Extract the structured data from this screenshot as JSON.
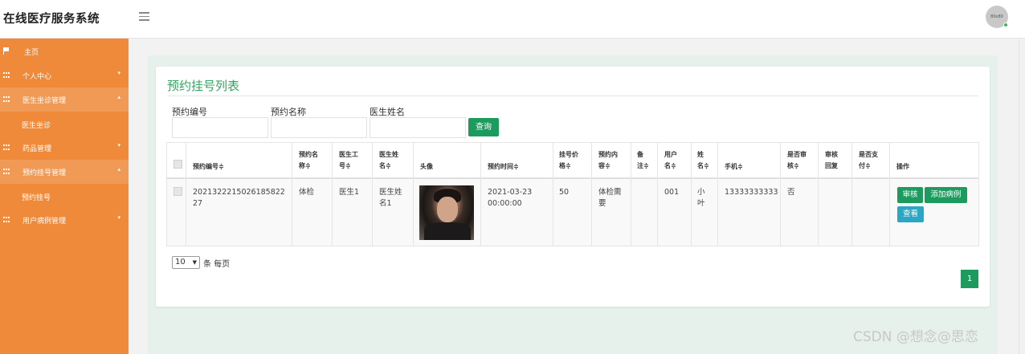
{
  "app": {
    "title": "在线医疗服务系统",
    "avatar_text": "80x80"
  },
  "sidebar": {
    "items": [
      {
        "label": "主页",
        "icon": "flag-icon"
      },
      {
        "label": "个人中心",
        "icon": "grid-icon",
        "caret": "▾"
      },
      {
        "label": "医生坐诊管理",
        "icon": "grid-icon",
        "caret": "▴"
      },
      {
        "label": "医生坐诊"
      },
      {
        "label": "药品管理",
        "icon": "grid-icon",
        "caret": "▾"
      },
      {
        "label": "预约挂号管理",
        "icon": "grid-icon",
        "caret": "▴"
      },
      {
        "label": "预约挂号"
      },
      {
        "label": "用户病例管理",
        "icon": "grid-icon",
        "caret": "▾"
      }
    ]
  },
  "page": {
    "title": "预约挂号列表"
  },
  "search": {
    "fields": [
      {
        "label": "预约编号",
        "value": ""
      },
      {
        "label": "预约名称",
        "value": ""
      },
      {
        "label": "医生姓名",
        "value": ""
      }
    ],
    "query_label": "查询"
  },
  "table": {
    "headers": [
      "预约编号≑",
      "预约名\n称≑",
      "医生工\n号≑",
      "医生姓\n名≑",
      "头像",
      "预约时间≑",
      "挂号价\n格≑",
      "预约内\n容≑",
      "备\n注≑",
      "用户\n名≑",
      "姓\n名≑",
      "手机≑",
      "是否审\n核≑",
      "审核\n回复",
      "是否支\n付≑",
      "操作"
    ],
    "rows": [
      {
        "cells": [
          "2021322215026185822 27",
          "体检",
          "医生1",
          "医生姓\n名1",
          "",
          "2021-03-23\n00:00:00",
          "50",
          "体检需\n要",
          "",
          "001",
          "小\n叶",
          "13333333333",
          "否",
          "",
          ""
        ],
        "actions": [
          "审核",
          "添加病例",
          "查看"
        ]
      }
    ]
  },
  "pagination": {
    "page_size": "10",
    "page_size_suffix": "条 每页",
    "current_page": "1"
  },
  "watermark": "CSDN @想念@思恋",
  "colors": {
    "sidebar": "#ef8a3a",
    "accent_green": "#1d9b5e",
    "title_green": "#2fa55f",
    "info_cyan": "#2aa7c4"
  }
}
